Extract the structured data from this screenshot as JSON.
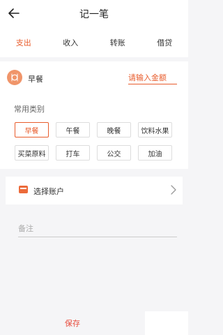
{
  "header": {
    "title": "记一笔",
    "back_icon": "arrow-left-icon"
  },
  "tabs": [
    {
      "label": "支出",
      "active": true
    },
    {
      "label": "收入",
      "active": false
    },
    {
      "label": "转账",
      "active": false
    },
    {
      "label": "借贷",
      "active": false
    }
  ],
  "selected_category": {
    "icon": "utensils-icon",
    "name": "早餐"
  },
  "amount": {
    "placeholder": "请输入金额",
    "value": ""
  },
  "categories": {
    "heading": "常用类别",
    "items": [
      "早餐",
      "午餐",
      "晚餐",
      "饮料水果",
      "买菜原料",
      "打车",
      "公交",
      "加油"
    ],
    "active_index": 0
  },
  "account": {
    "label": "选择账户",
    "icon": "card-icon",
    "chevron_icon": "chevron-right-icon"
  },
  "note": {
    "placeholder": "备注",
    "value": ""
  },
  "footer": {
    "save_label": "保存"
  },
  "colors": {
    "accent": "#e85c2c",
    "save": "#e84c3d",
    "background": "#f5f5f7"
  }
}
